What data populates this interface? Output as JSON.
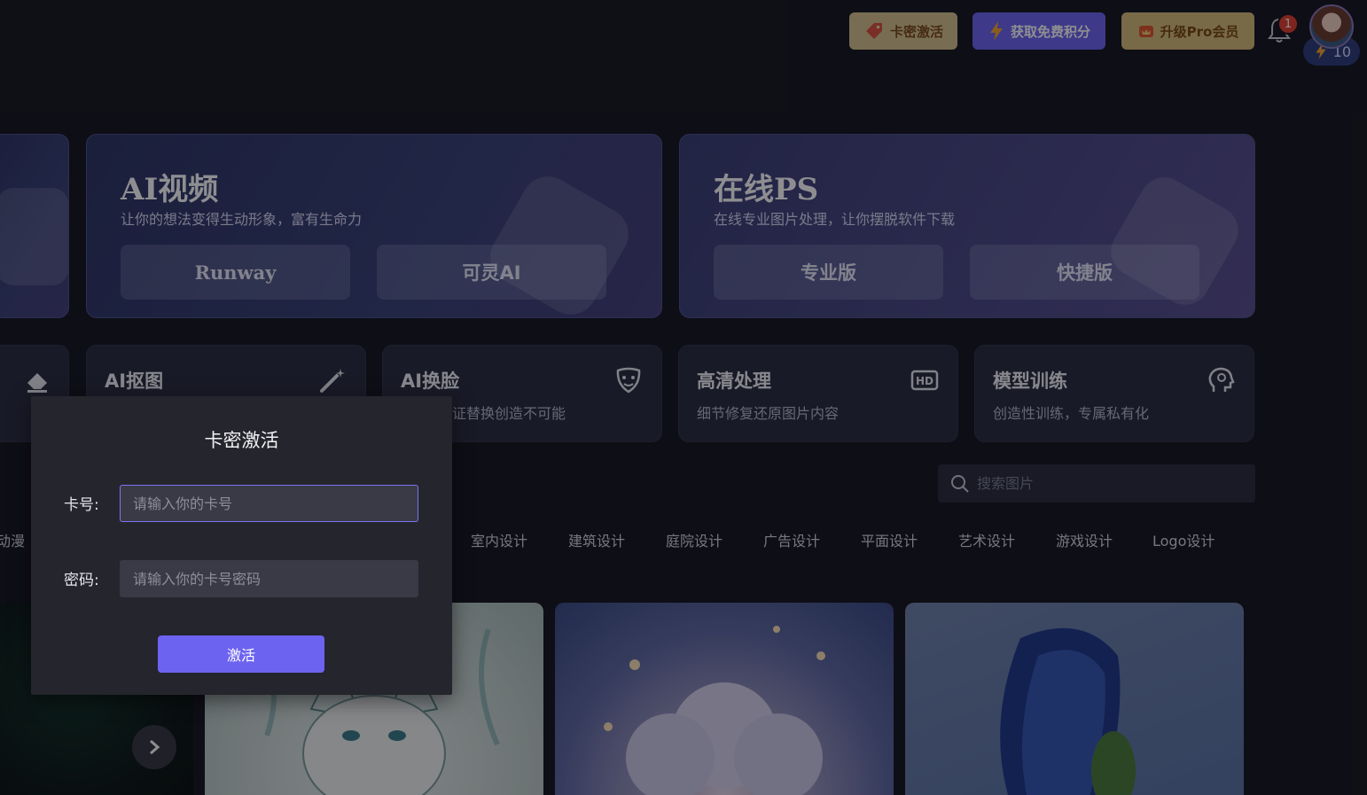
{
  "header": {
    "card_activate": "卡密激活",
    "get_points": "获取免费积分",
    "upgrade_pro": "升级Pro会员",
    "notification_count": "1",
    "points": "10"
  },
  "features": {
    "video": {
      "title": "AI视频",
      "subtitle": "让你的想法变得生动形象，富有生命力",
      "btn1": "Runway",
      "btn2": "可灵AI"
    },
    "ps": {
      "title": "在线PS",
      "subtitle": "在线专业图片处理，让你摆脱软件下载",
      "btn1": "专业版",
      "btn2": "快捷版"
    }
  },
  "tools": [
    {
      "title": "AI抠图",
      "subtitle": ""
    },
    {
      "title": "AI换脸",
      "subtitle": "证替换创造不可能"
    },
    {
      "title": "高清处理",
      "subtitle": "细节修复还原图片内容"
    },
    {
      "title": "模型训练",
      "subtitle": "创造性训练，专属私有化"
    }
  ],
  "search": {
    "placeholder": "搜索图片"
  },
  "categories": [
    "动漫",
    "室内设计",
    "建筑设计",
    "庭院设计",
    "广告设计",
    "平面设计",
    "艺术设计",
    "游戏设计",
    "Logo设计"
  ],
  "modal": {
    "title": "卡密激活",
    "card_label": "卡号:",
    "card_placeholder": "请输入你的卡号",
    "password_label": "密码:",
    "password_placeholder": "请输入你的卡号密码",
    "submit": "激活"
  },
  "colors": {
    "accent": "#6c63f0",
    "card_btn_bg": "#d8c38c",
    "pro_btn_bg": "#d8bd79"
  }
}
